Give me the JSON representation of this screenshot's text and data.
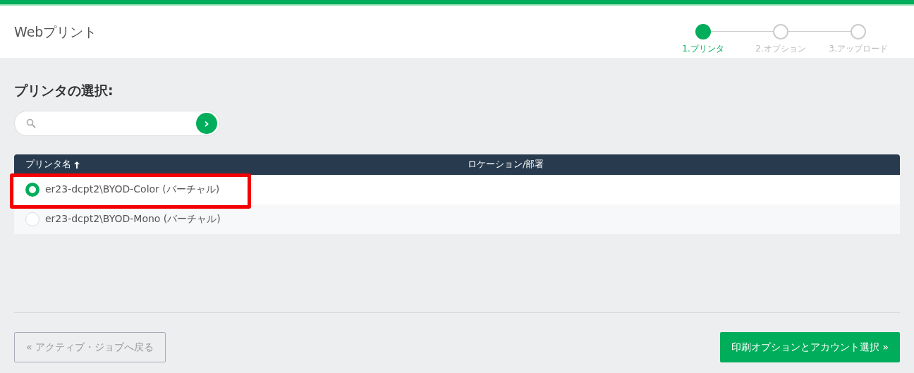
{
  "app_title": "Webプリント",
  "steps": [
    {
      "label": "1.プリンタ",
      "selected": true
    },
    {
      "label": "2.オプション",
      "selected": false
    },
    {
      "label": "3.アップロード",
      "selected": false
    }
  ],
  "heading": "プリンタの選択:",
  "search": {
    "button": "›"
  },
  "table": {
    "columns": [
      {
        "label": "プリンタ名"
      },
      {
        "label": "ロケーション/部署"
      }
    ],
    "rows": [
      {
        "name": "er23-dcpt2\\BYOD-Color (バーチャル)",
        "selected": true,
        "highlighted": true
      },
      {
        "name": "er23-dcpt2\\BYOD-Mono (バーチャル)",
        "selected": false,
        "highlighted": false
      }
    ]
  },
  "back_button": "« アクティブ・ジョブへ戻る",
  "next_button": "印刷オプションとアカウント選択 »"
}
